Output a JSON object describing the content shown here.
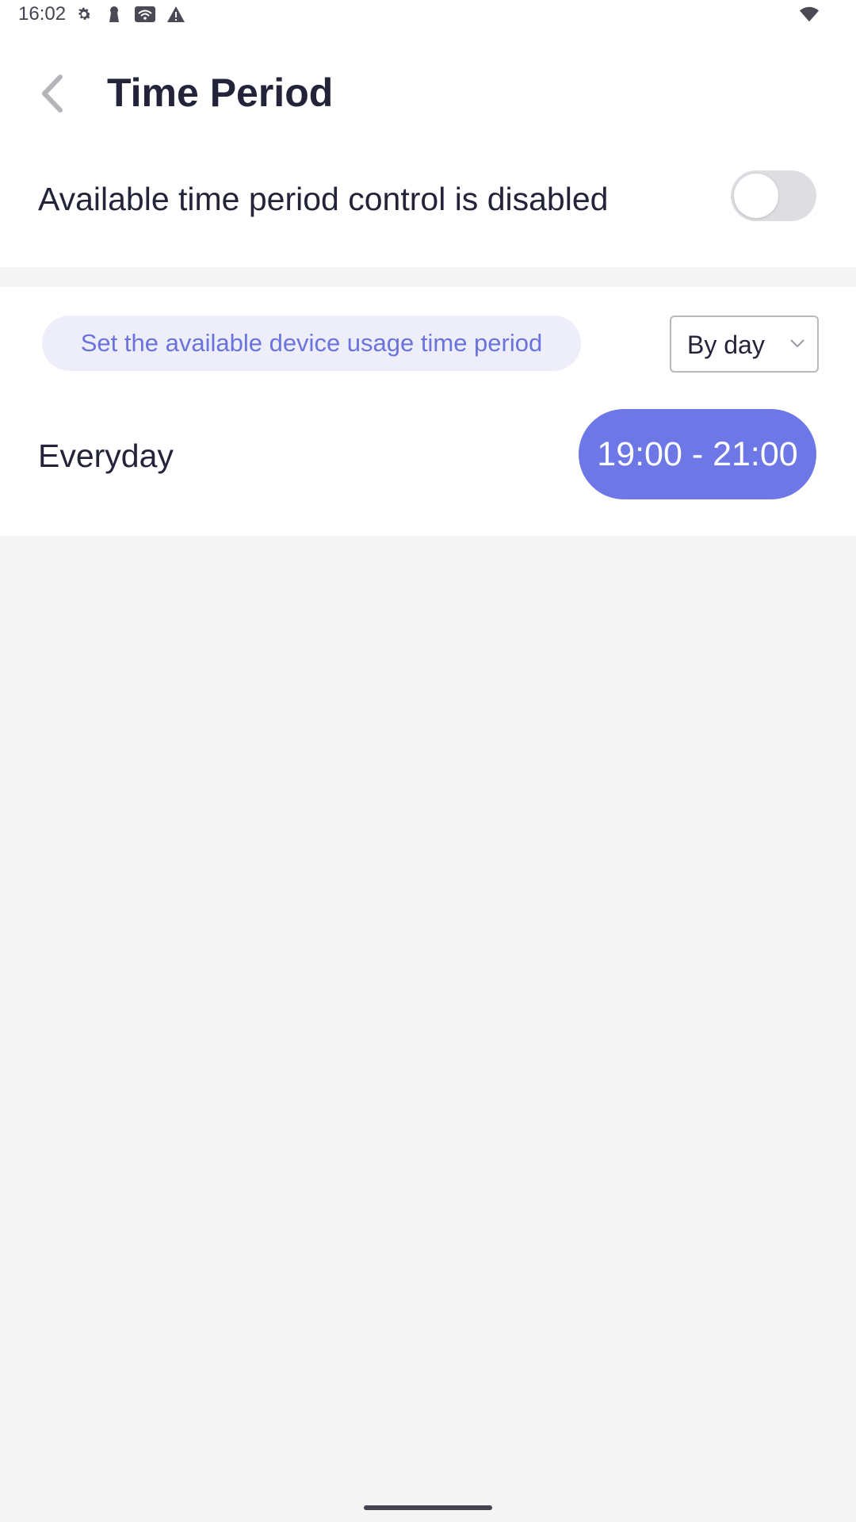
{
  "status_bar": {
    "time": "16:02",
    "icons": [
      "gear-icon",
      "keyhole-icon",
      "wifi-box-icon",
      "warning-icon",
      "wifi-signal-icon"
    ]
  },
  "header": {
    "title": "Time Period",
    "back_icon": "chevron-left-icon"
  },
  "control": {
    "label": "Available time period control is disabled",
    "enabled": false
  },
  "schedule": {
    "hint": "Set the available device usage time period",
    "mode_selected": "By day",
    "rows": [
      {
        "day": "Everyday",
        "time_range": "19:00 - 21:00"
      }
    ]
  },
  "colors": {
    "accent": "#6d78e6",
    "hint_text": "#6a73dc",
    "hint_bg": "#eeeefb",
    "background": "#f4f4f5"
  }
}
